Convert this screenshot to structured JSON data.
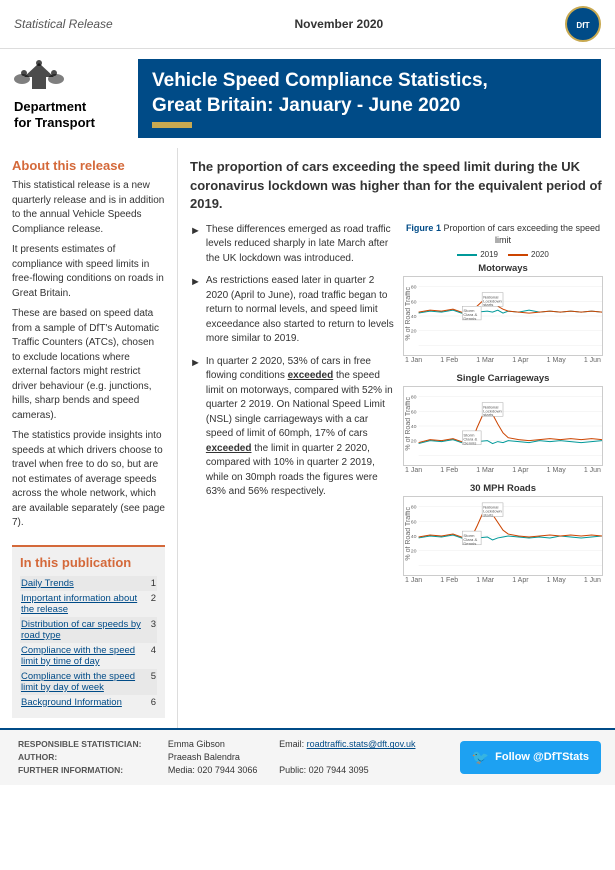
{
  "topbar": {
    "title": "Statistical Release",
    "date": "November 2020"
  },
  "header": {
    "org_name": "Department\nfor Transport",
    "title_line1": "Vehicle Speed Compliance Statistics,",
    "title_line2": "Great Britain: January - June 2020"
  },
  "about": {
    "title": "About this release",
    "paragraphs": [
      "This statistical release is a new quarterly release and is in addition to the annual Vehicle Speeds Compliance release.",
      "It presents estimates of compliance with speed limits in free-flowing conditions on roads in Great Britain.",
      "These are based on speed data from a sample of DfT's Automatic Traffic Counters (ATCs), chosen to exclude locations where external factors might restrict driver behaviour (e.g. junctions, hills, sharp bends and speed cameras).",
      "The statistics provide insights into speeds at which drivers choose to travel when free to do so, but are not estimates of average speeds across the whole network, which are available separately (see page 7)."
    ]
  },
  "in_publication": {
    "title": "In this publication",
    "items": [
      {
        "label": "Daily Trends",
        "page": "1"
      },
      {
        "label": "Important information about the release",
        "page": "2"
      },
      {
        "label": "Distribution of car speeds by road type",
        "page": "3"
      },
      {
        "label": "Compliance with the speed limit by time of day",
        "page": "4"
      },
      {
        "label": "Compliance with the speed limit by day of week",
        "page": "5"
      },
      {
        "label": "Background Information",
        "page": "6"
      }
    ]
  },
  "main": {
    "heading": "The proportion of cars exceeding the speed limit during the UK coronavirus lockdown was higher than for the equivalent period of 2019.",
    "bullets": [
      "These differences emerged as road traffic levels reduced sharply in late March after the UK lockdown was introduced.",
      "As restrictions eased later in quarter 2 2020 (April to June), road traffic began to return to normal levels, and speed limit exceedance also started to return to levels more similar to 2019.",
      "In quarter 2 2020, 53% of cars in free flowing conditions exceeded the speed limit on motorways, compared with 52% in quarter 2 2019. On National Speed Limit (NSL) single carriageways with a car speed of limit of 60mph, 17% of cars exceeded the limit in quarter 2 2020, compared with 10% in quarter 2 2019, while on 30mph roads the figures were 63% and 56% respectively."
    ],
    "bold_words": [
      "exceeded",
      "exceeded"
    ]
  },
  "figure": {
    "title": "Figure 1",
    "subtitle": "Proportion of cars exceeding the speed limit",
    "legend": {
      "y2019": "2019",
      "y2020": "2020"
    },
    "charts": [
      {
        "title": "Motorways",
        "yaxis": "% of Road Traffic",
        "xaxis": [
          "1 Jan",
          "1 Feb",
          "1 Mar",
          "1 Apr",
          "1 May",
          "1 Jun"
        ]
      },
      {
        "title": "Single Carriageways",
        "yaxis": "% of Road Traffic",
        "xaxis": [
          "1 Jan",
          "1 Feb",
          "1 Mar",
          "1 Apr",
          "1 May",
          "1 Jun"
        ]
      },
      {
        "title": "30 MPH Roads",
        "yaxis": "% of Road Traffic",
        "xaxis": [
          "1 Jan",
          "1 Feb",
          "1 Mar",
          "1 Apr",
          "1 May",
          "1 Jun"
        ]
      }
    ],
    "annotations": {
      "storm": "Storm\nClara &\nDennis",
      "lockdown": "National\nLockdown\nstarts"
    }
  },
  "footer": {
    "responsible_statistician_label": "RESPONSIBLE STATISTICIAN:",
    "responsible_statistician": "Emma Gibson",
    "author_label": "AUTHOR:",
    "author": "Praeash Balendra",
    "further_info_label": "FURTHER INFORMATION:",
    "further_info_media": "Media: 020 7944 3066",
    "further_info_public": "Public: 020 7944 3095",
    "email_label": "Email:",
    "email": "roadtraffic.stats@dft.gov.uk",
    "follow_label": "Follow @DfTStats"
  }
}
